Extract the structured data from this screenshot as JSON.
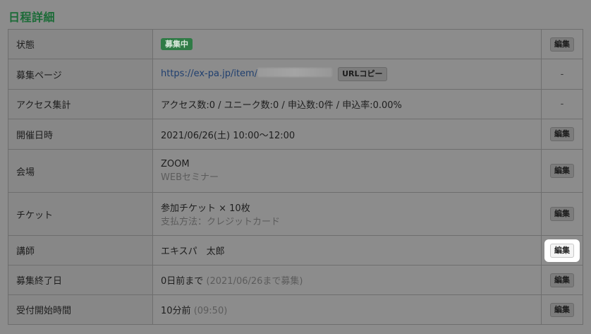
{
  "section_title": "日程詳細",
  "rows": [
    {
      "label": "状態",
      "badge": "募集中",
      "action": "編集"
    },
    {
      "label": "募集ページ",
      "url": "https://ex-pa.jp/item/",
      "copy_button": "URLコピー",
      "action": "-"
    },
    {
      "label": "アクセス集計",
      "value": "アクセス数:0 / ユニーク数:0 / 申込数:0件 / 申込率:0.00%",
      "action": "-"
    },
    {
      "label": "開催日時",
      "value": "2021/06/26(土) 10:00〜12:00",
      "action": "編集"
    },
    {
      "label": "会場",
      "value": "ZOOM",
      "sub": "WEBセミナー",
      "action": "編集"
    },
    {
      "label": "チケット",
      "value": "参加チケット × 10枚",
      "sub": "支払方法：クレジットカード",
      "action": "編集"
    },
    {
      "label": "講師",
      "value": "エキスパ　太郎",
      "action": "編集"
    },
    {
      "label": "募集終了日",
      "value": "0日前まで",
      "muted": "(2021/06/26まで募集)",
      "action": "編集"
    },
    {
      "label": "受付開始時間",
      "value": "10分前",
      "muted": "(09:50)",
      "action": "編集"
    }
  ]
}
